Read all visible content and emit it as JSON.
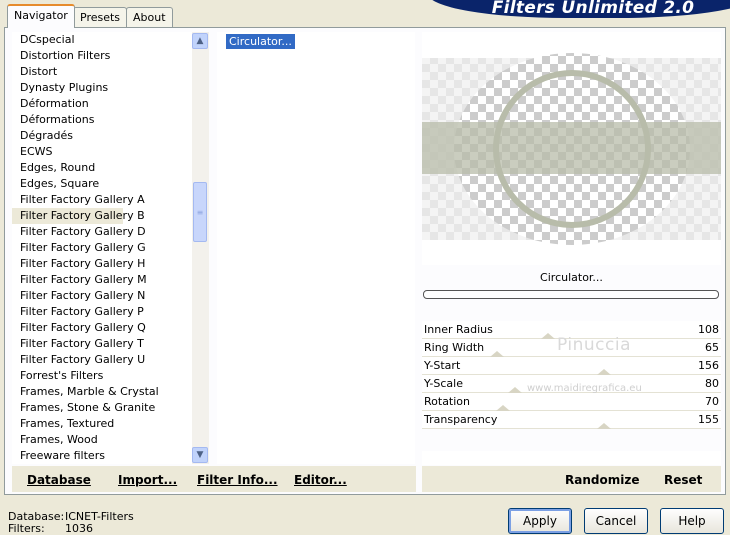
{
  "app": {
    "title": "Filters Unlimited 2.0"
  },
  "tabs": [
    "Navigator",
    "Presets",
    "About"
  ],
  "categories": [
    "DCspecial",
    "Distortion Filters",
    "Distort",
    "Dynasty Plugins",
    "Déformation",
    "Déformations",
    "Dégradés",
    "ECWS",
    "Edges, Round",
    "Edges, Square",
    "Filter Factory Gallery A",
    "Filter Factory Gallery B",
    "Filter Factory Gallery D",
    "Filter Factory Gallery G",
    "Filter Factory Gallery H",
    "Filter Factory Gallery M",
    "Filter Factory Gallery N",
    "Filter Factory Gallery P",
    "Filter Factory Gallery Q",
    "Filter Factory Gallery T",
    "Filter Factory Gallery U",
    "Forrest's Filters",
    "Frames, Marble & Crystal",
    "Frames, Stone & Granite",
    "Frames, Textured",
    "Frames, Wood",
    "Freeware filters"
  ],
  "selected_category": "Filter Factory Gallery B",
  "filters": [
    "Circulator..."
  ],
  "left_buttons": {
    "database": "Database",
    "import": "Import...",
    "filter_info": "Filter Info...",
    "editor": "Editor..."
  },
  "current_filter": "Circulator...",
  "params": [
    {
      "name": "Inner Radius",
      "value": "108",
      "fraction": 0.42
    },
    {
      "name": "Ring Width",
      "value": "65",
      "fraction": 0.25
    },
    {
      "name": "Y-Start",
      "value": "156",
      "fraction": 0.61
    },
    {
      "name": "Y-Scale",
      "value": "80",
      "fraction": 0.31
    },
    {
      "name": "Rotation",
      "value": "70",
      "fraction": 0.27
    },
    {
      "name": "Transparency",
      "value": "155",
      "fraction": 0.61
    }
  ],
  "watermark": {
    "name": "Pinuccia",
    "url": "www.maidiregrafica.eu"
  },
  "right_buttons": {
    "randomize": "Randomize",
    "reset": "Reset"
  },
  "status": {
    "database_label": "Database:",
    "database_value": "ICNET-Filters",
    "filters_label": "Filters:",
    "filters_value": "1036"
  },
  "dialog_buttons": {
    "apply": "Apply",
    "cancel": "Cancel",
    "help": "Help"
  },
  "colors": {
    "banner": "#0a246a",
    "ring": "#b8bcaa",
    "selection": "#316ac5",
    "tab_accent": "#e68b2c"
  }
}
